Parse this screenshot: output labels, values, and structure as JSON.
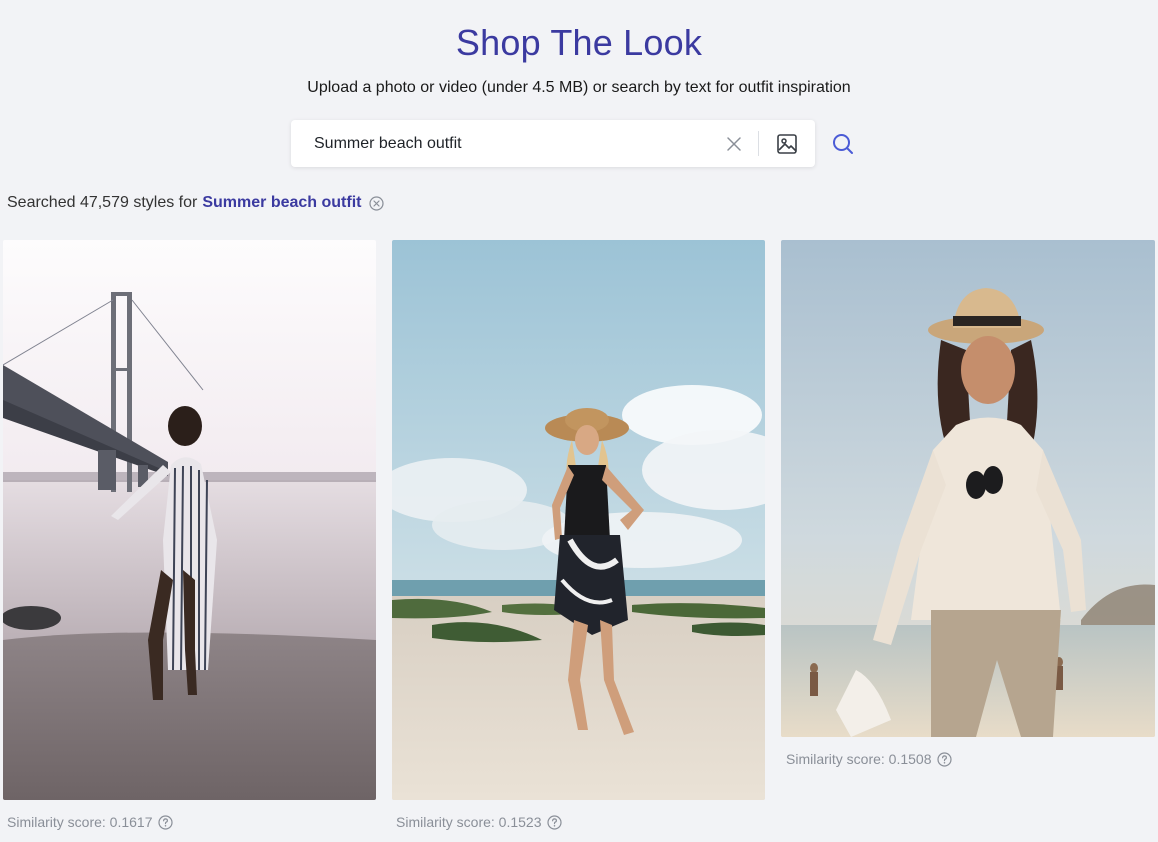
{
  "header": {
    "title": "Shop The Look",
    "subtitle": "Upload a photo or video (under 4.5 MB) or search by text for outfit inspiration"
  },
  "search": {
    "value": "Summer beach outfit",
    "clear_icon": "close-icon",
    "upload_icon": "image-icon",
    "submit_icon": "search-icon"
  },
  "results": {
    "prefix": "Searched 47,579 styles for",
    "query": "Summer beach outfit",
    "clear_query_icon": "x-circle-icon"
  },
  "cards": [
    {
      "score_label": "Similarity score: 0.1617",
      "scene": "bridge beach at sunset, woman in striped shirt dress"
    },
    {
      "score_label": "Similarity score: 0.1523",
      "scene": "sandy beach, woman in straw hat and black swimsuit with sarong"
    },
    {
      "score_label": "Similarity score: 0.1508",
      "scene": "beach at golden hour, woman in fedora and cream off-shoulder sweater"
    }
  ],
  "colors": {
    "accent": "#3b3aa0",
    "background": "#f2f3f6",
    "muted_text": "#8a8f98"
  }
}
